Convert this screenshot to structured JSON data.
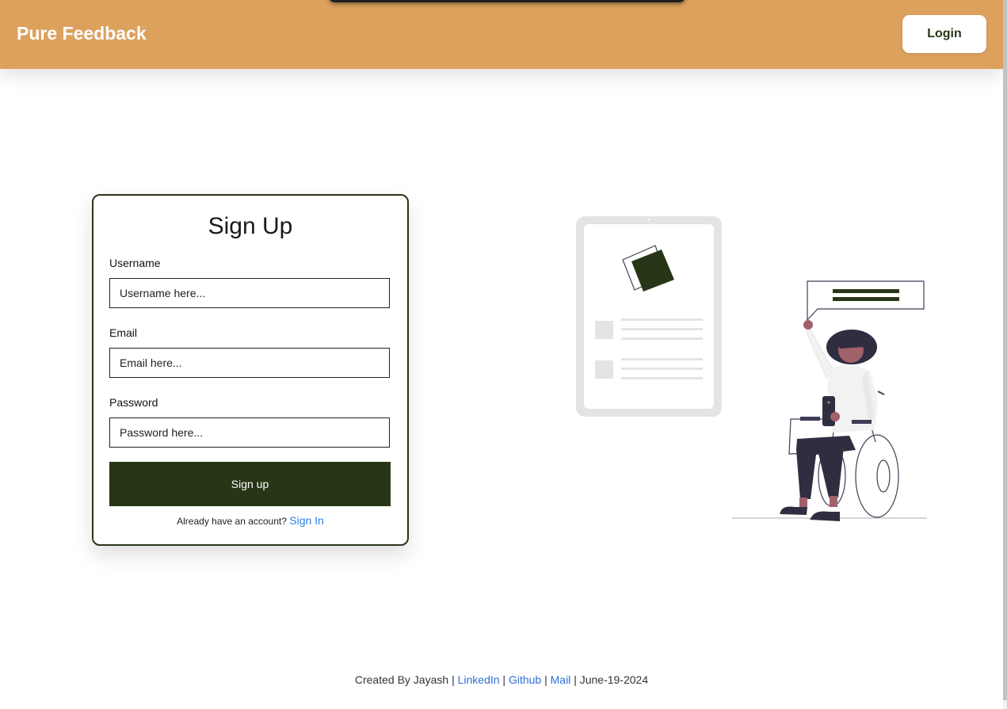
{
  "header": {
    "brand": "Pure Feedback",
    "login_label": "Login"
  },
  "form": {
    "title": "Sign Up",
    "username": {
      "label": "Username",
      "placeholder": "Username here..."
    },
    "email": {
      "label": "Email",
      "placeholder": "Email here..."
    },
    "password": {
      "label": "Password",
      "placeholder": "Password here..."
    },
    "submit_label": "Sign up",
    "signin_prompt": "Already have an account?",
    "signin_link": "Sign In"
  },
  "footer": {
    "created_by": "Created By Jayash",
    "sep": "|",
    "linkedin": "LinkedIn",
    "github": "Github",
    "mail": "Mail",
    "date": "June-19-2024"
  },
  "colors": {
    "header_bg": "#dda15e",
    "accent_dark": "#283618",
    "link": "#2f80ed"
  }
}
